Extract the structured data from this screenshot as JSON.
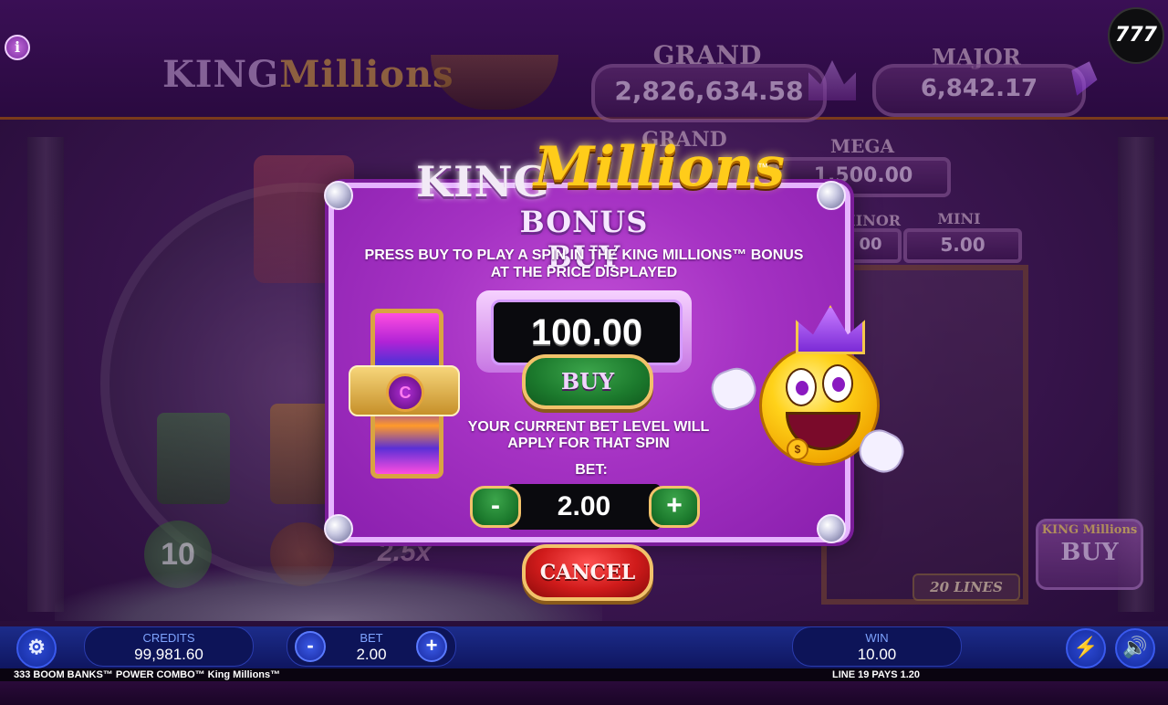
{
  "background": {
    "logo_king": "KING",
    "logo_millions": "Millions",
    "jackpots_top": [
      {
        "label": "GRAND",
        "value": "2,826,634.58"
      },
      {
        "label": "MAJOR",
        "value": "6,842.17"
      }
    ],
    "jackpots_mid": [
      {
        "label": "GRAND",
        "value": ""
      },
      {
        "label": "MEGA",
        "value": "1,500.00"
      },
      {
        "label": "MINOR",
        "value": "00"
      },
      {
        "label": "MINI",
        "value": "5.00"
      }
    ],
    "side_buy_logo": "KING Millions",
    "side_buy_label": "BUY",
    "lines_badge": "20 LINES",
    "multiplier": "2.5x",
    "free_spins": "10"
  },
  "logo_777": "777",
  "info_icon": "i",
  "modal": {
    "title_king": "KING",
    "title_millions": "Millions",
    "title_tm": "™",
    "subtitle": "BONUS BUY",
    "description_line1": "PRESS BUY TO PLAY A SPIN IN THE KING MILLIONS™ BONUS",
    "description_line2": "AT THE PRICE DISPLAYED",
    "price": "100.00",
    "buy_label": "BUY",
    "bet_note_line1": "YOUR CURRENT BET LEVEL WILL",
    "bet_note_line2": "APPLY FOR THAT SPIN",
    "bet_label": "BET:",
    "bet_value": "2.00",
    "minus_label": "-",
    "plus_label": "+",
    "cancel_label": "CANCEL",
    "mascot_dollar": "$"
  },
  "hud": {
    "credits_label": "CREDITS",
    "credits_value": "99,981.60",
    "bet_label": "BET",
    "bet_value": "2.00",
    "bet_minus": "-",
    "bet_plus": "+",
    "win_label": "WIN",
    "win_value": "10.00",
    "game_name": "333 BOOM BANKS™ POWER COMBO™ King Millions™",
    "line_pays": "LINE 19 PAYS 1.20"
  },
  "icons": {
    "settings": "gear-icon",
    "turbo": "lightning-icon",
    "sound": "speaker-icon",
    "info": "info-icon"
  },
  "colors": {
    "modal_purple": "#a532c3",
    "buy_green": "#1c7a2d",
    "cancel_red": "#d01b1b",
    "gold": "#ffcc1a",
    "hud_blue": "#1c2c8a"
  }
}
